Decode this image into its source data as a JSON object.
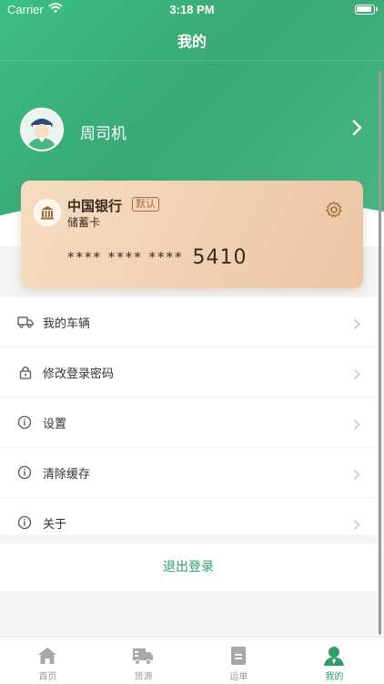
{
  "status_bar": {
    "carrier": "Carrier",
    "time": "3:18 PM"
  },
  "nav": {
    "title": "我的"
  },
  "profile": {
    "name": "周司机"
  },
  "bank_card": {
    "bank_name": "中国银行",
    "badge": "默认",
    "card_type": "储蓄卡",
    "masked_number": "**** **** ****",
    "last4": "5410"
  },
  "menu": [
    {
      "label": "我的车辆",
      "icon": "truck-icon"
    },
    {
      "label": "修改登录密码",
      "icon": "lock-icon"
    },
    {
      "label": "设置",
      "icon": "info-icon"
    },
    {
      "label": "清除缓存",
      "icon": "info-icon"
    },
    {
      "label": "关于",
      "icon": "info-icon"
    }
  ],
  "logout_label": "退出登录",
  "tabs": [
    {
      "label": "首页",
      "icon": "home-icon"
    },
    {
      "label": "货源",
      "icon": "truck-icon"
    },
    {
      "label": "运单",
      "icon": "document-icon"
    },
    {
      "label": "我的",
      "icon": "user-icon",
      "active": true
    }
  ],
  "colors": {
    "brand_green": "#2f9e6a",
    "card_gold": "#f1d2b6"
  }
}
